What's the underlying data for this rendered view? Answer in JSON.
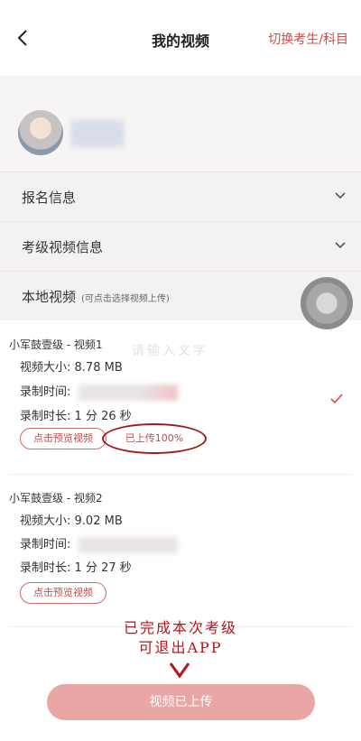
{
  "nav": {
    "back_icon": "chevron-left-icon",
    "title": "我的视频",
    "switch_label": "切换考生/科目"
  },
  "sections": [
    {
      "label": "报名信息",
      "hint": "",
      "icon": "chevron-down-icon"
    },
    {
      "label": "考级视频信息",
      "hint": "",
      "icon": "chevron-down-icon"
    },
    {
      "label": "本地视频",
      "hint": "(可点击选择视频上传)",
      "icon": ""
    }
  ],
  "videos": [
    {
      "title": "小军鼓壹级 - 视频1",
      "size_label": "视频大小:",
      "size_value": "8.78 MB",
      "time_label": "录制时间:",
      "duration_label": "录制时长:",
      "duration_value": "1 分 26 秒",
      "preview_button": "点击预览视频",
      "upload_status": "已上传100%"
    },
    {
      "title": "小军鼓壹级 - 视频2",
      "size_label": "视频大小:",
      "size_value": "9.02 MB",
      "time_label": "录制时间:",
      "duration_label": "录制时长:",
      "duration_value": "1 分 27 秒",
      "preview_button": "点击预览视频"
    }
  ],
  "watermark": "请输入文字",
  "annotation": {
    "line1": "已完成本次考级",
    "line2": "可退出APP",
    "color": "#b4161c"
  },
  "submit_button": "视频已上传",
  "colors": {
    "accent": "#d04b47",
    "submit_bg": "#eaa6a4",
    "section_bg": "#f4f1f2"
  }
}
